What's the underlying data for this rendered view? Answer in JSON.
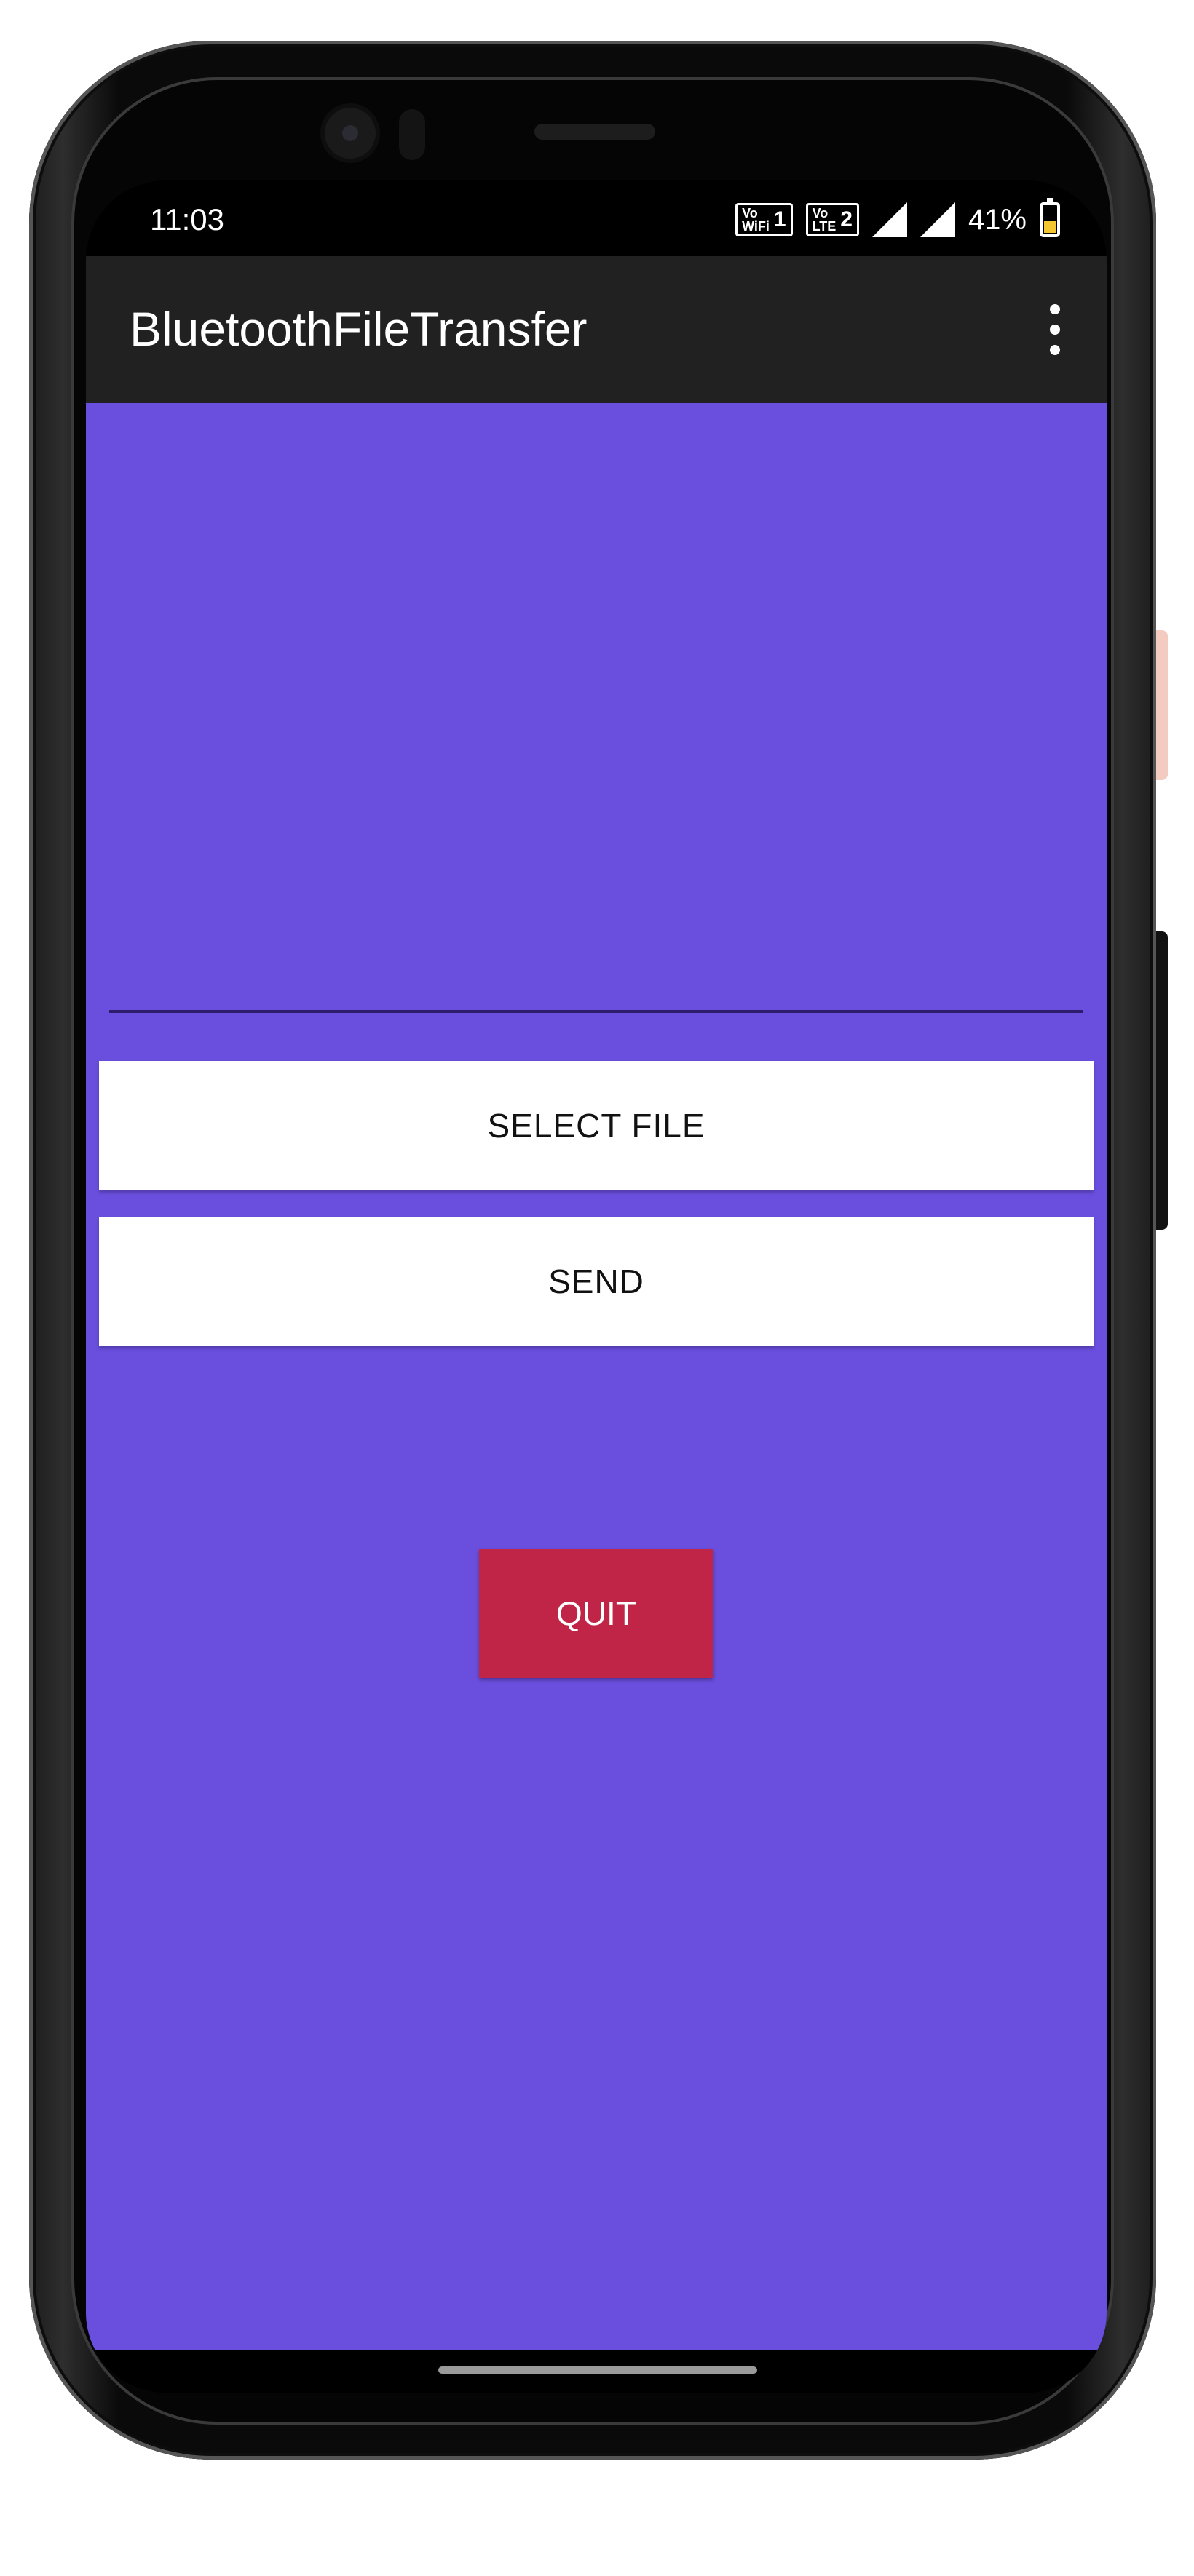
{
  "status_bar": {
    "time": "11:03",
    "sim1": {
      "top": "Vo",
      "bottom": "WiFi",
      "num": "1"
    },
    "sim2": {
      "top": "Vo",
      "bottom": "LTE",
      "num": "2"
    },
    "battery_percent": "41%"
  },
  "app_bar": {
    "title": "BluetoothFileTransfer"
  },
  "main": {
    "file_input_value": "",
    "select_file_label": "SELECT FILE",
    "send_label": "SEND",
    "quit_label": "QUIT"
  },
  "colors": {
    "background": "#6a4fdf",
    "app_bar": "#212121",
    "quit_button": "#c02548",
    "battery": "#f3c531"
  },
  "icons": {
    "overflow": "more-vert-icon",
    "signal": "cell-signal-icon",
    "battery": "battery-charging-icon"
  }
}
